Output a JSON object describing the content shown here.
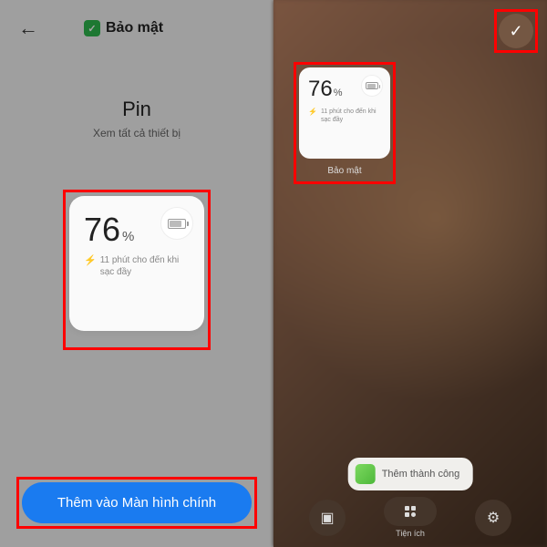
{
  "left": {
    "header": {
      "title": "Bảo mật"
    },
    "section": {
      "title": "Pin",
      "subtitle": "Xem tất cả thiết bị"
    },
    "widget": {
      "percent": "76",
      "percent_symbol": "%",
      "charge_text": "11 phút cho đến khi sạc đầy"
    },
    "button": "Thêm vào Màn hình chính"
  },
  "right": {
    "widget": {
      "percent": "76",
      "percent_symbol": "%",
      "charge_text": "11 phút cho đến khi sạc đầy",
      "label": "Bảo mật"
    },
    "toast": "Thêm thành công",
    "bar": {
      "widgets": "Tiện ích"
    }
  }
}
